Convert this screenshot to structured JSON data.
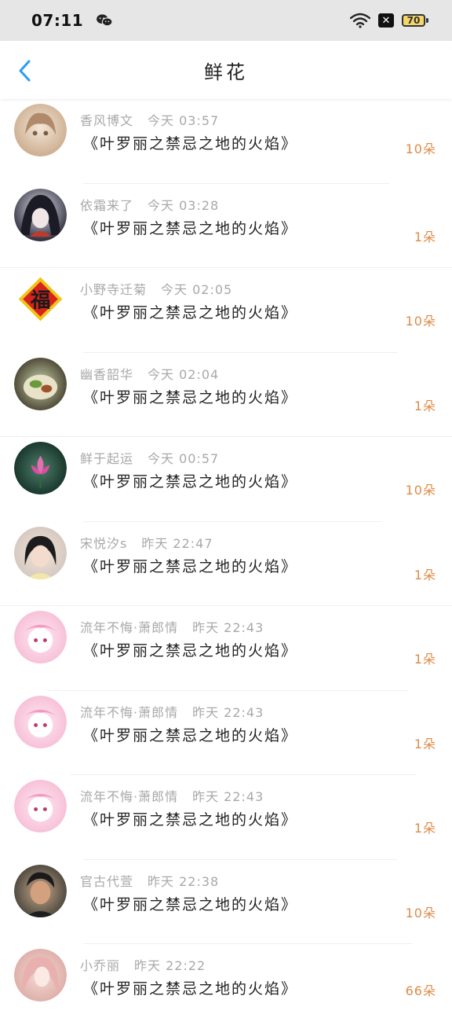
{
  "status": {
    "time": "07:11",
    "battery": "70"
  },
  "header": {
    "title": "鲜花"
  },
  "colors": {
    "accent": "#e08a45",
    "back": "#2a9df4"
  },
  "entries": [
    {
      "name": "香风博文",
      "time": "今天 03:57",
      "book": "《叶罗丽之禁忌之地的火焰》",
      "count": "10朵"
    },
    {
      "name": "依霜来了",
      "time": "今天 03:28",
      "book": "《叶罗丽之禁忌之地的火焰》",
      "count": "1朵"
    },
    {
      "name": "小野寺迁菊",
      "time": "今天 02:05",
      "book": "《叶罗丽之禁忌之地的火焰》",
      "count": "10朵"
    },
    {
      "name": "幽香韶华",
      "time": "今天 02:04",
      "book": "《叶罗丽之禁忌之地的火焰》",
      "count": "1朵"
    },
    {
      "name": "鲜于起运",
      "time": "今天 00:57",
      "book": "《叶罗丽之禁忌之地的火焰》",
      "count": "10朵"
    },
    {
      "name": "宋悦汐s",
      "time": "昨天 22:47",
      "book": "《叶罗丽之禁忌之地的火焰》",
      "count": "1朵"
    },
    {
      "name": "流年不悔·萧郎情",
      "time": "昨天 22:43",
      "book": "《叶罗丽之禁忌之地的火焰》",
      "count": "1朵"
    },
    {
      "name": "流年不悔·萧郎情",
      "time": "昨天 22:43",
      "book": "《叶罗丽之禁忌之地的火焰》",
      "count": "1朵"
    },
    {
      "name": "流年不悔·萧郎情",
      "time": "昨天 22:43",
      "book": "《叶罗丽之禁忌之地的火焰》",
      "count": "1朵"
    },
    {
      "name": "官古代萱",
      "time": "昨天 22:38",
      "book": "《叶罗丽之禁忌之地的火焰》",
      "count": "10朵"
    },
    {
      "name": "小乔丽",
      "time": "昨天 22:22",
      "book": "《叶罗丽之禁忌之地的火焰》",
      "count": "66朵"
    }
  ]
}
